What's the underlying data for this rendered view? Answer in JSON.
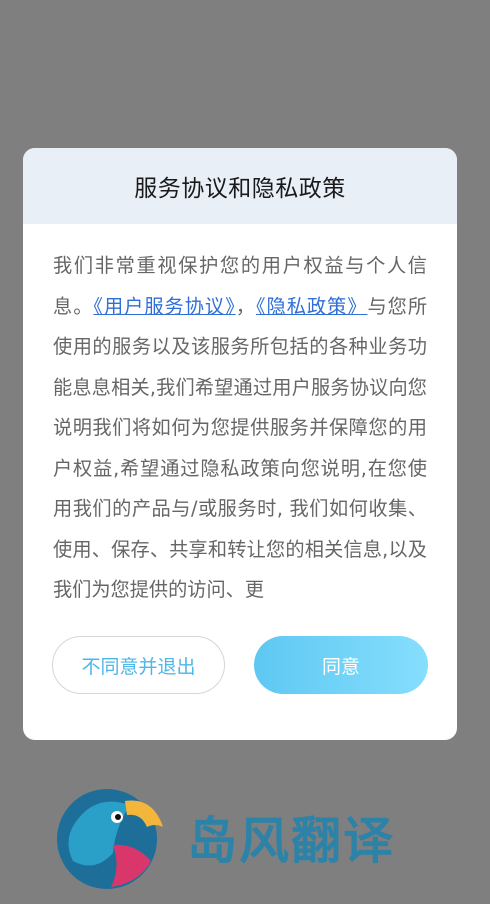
{
  "dialog": {
    "title": "服务协议和隐私政策",
    "body_intro": "我们非常重视保护您的用户权益与个人信息。",
    "link_user_agreement": "《用户服务协议》",
    "separator": "，",
    "link_privacy_policy": "《隐私政策》",
    "body_rest": "与您所使用的服务以及该服务所包括的各种业务功能息息相关,我们希望通过用户服务协议向您说明我们将如何为您提供服务并保障您的用户权益,希望通过隐私政策向您说明,在您使用我们的产品与/或服务时, 我们如何收集、使用、保存、共享和转让您的相关信息,以及我们为您提供的访问、更",
    "disagree_label": "不同意并退出",
    "agree_label": "同意"
  },
  "brand": {
    "name": "岛风翻译",
    "logo_icon": "parrot-logo-icon"
  },
  "colors": {
    "overlay": "#7f7f7f",
    "header_bg": "#e8eff6",
    "link": "#2f6fd6",
    "accent_start": "#5ec8f2",
    "accent_end": "#86defd",
    "brand_text": "#2d82a8"
  }
}
